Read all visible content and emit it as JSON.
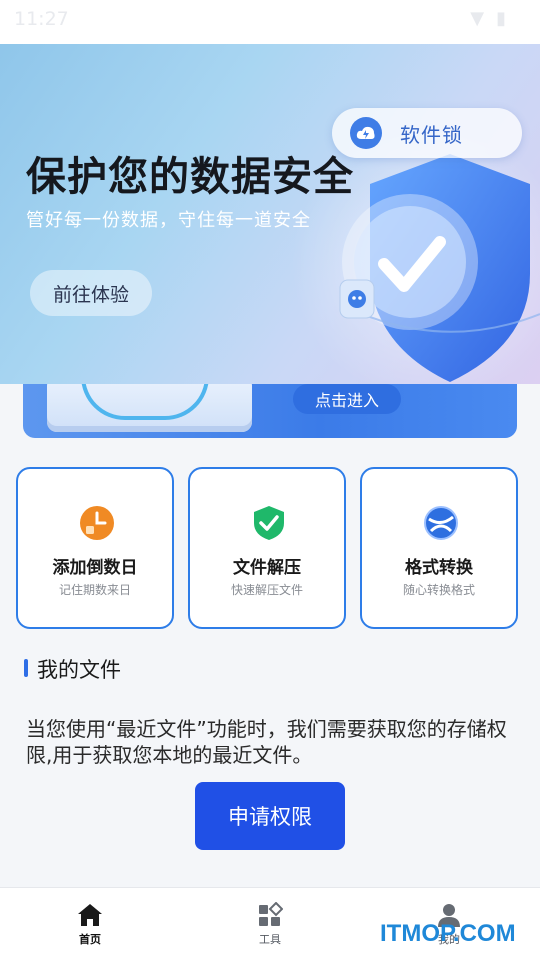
{
  "status_bar": {
    "time": "11:27"
  },
  "banner": {
    "title": "保护您的数据安全",
    "subtitle": "管好每一份数据，守住每一道安全",
    "cta_label": "前往体验",
    "lock_label": "软件锁"
  },
  "promo": {
    "button_label": "点击进入"
  },
  "tools": [
    {
      "title": "添加倒数日",
      "desc": "记住期数来日",
      "icon": "countdown-clock-icon",
      "color": "#f08a24"
    },
    {
      "title": "文件解压",
      "desc": "快速解压文件",
      "icon": "shield-check-icon",
      "color": "#1fb86a"
    },
    {
      "title": "格式转换",
      "desc": "随心转换格式",
      "icon": "convert-globe-icon",
      "color": "#2e6fe0"
    }
  ],
  "my_files": {
    "title": "我的文件",
    "permission_text": "当您使用“最近文件”功能时，我们需要获取您的存储权限,用于获取您本地的最近文件。",
    "button_label": "申请权限"
  },
  "tab_bar": {
    "items": [
      {
        "label": "首页",
        "icon": "home-icon",
        "active": true
      },
      {
        "label": "工具",
        "icon": "tools-grid-icon",
        "active": false
      },
      {
        "label": "我的",
        "icon": "user-icon",
        "active": false
      }
    ]
  },
  "watermark": "ITMOP.COM",
  "colors": {
    "accent": "#2050e6",
    "card_border": "#2e7de8",
    "section_bar": "#2e6ee6"
  }
}
